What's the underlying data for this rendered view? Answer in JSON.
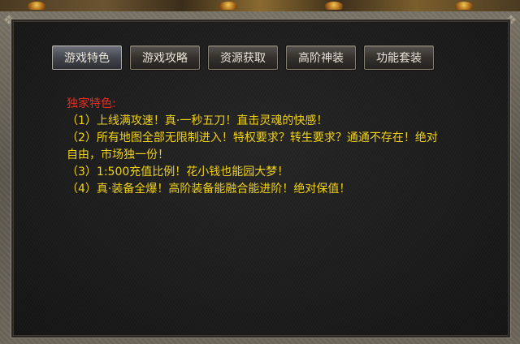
{
  "tabs": [
    {
      "label": "游戏特色",
      "active": true
    },
    {
      "label": "游戏攻略",
      "active": false
    },
    {
      "label": "资源获取",
      "active": false
    },
    {
      "label": "高阶神装",
      "active": false
    },
    {
      "label": "功能套装",
      "active": false
    }
  ],
  "content": {
    "heading": "独家特色:",
    "lines": [
      "（1）上线满攻速！真·一秒五刀！直击灵魂的快感！",
      "（2）所有地图全部无限制进入！特权要求？转生要求？通通不存在！绝对",
      "自由，市场独一份！",
      "（3）1:500充值比例！花小钱也能园大梦！",
      "（4）真·装备全爆！高阶装备能融合能进阶！绝对保值！"
    ]
  },
  "colors": {
    "heading": "#ee2a1f",
    "body_text": "#f0d21a",
    "tab_text": "#e9e4d8",
    "panel_bg": "#1c1c1c"
  }
}
